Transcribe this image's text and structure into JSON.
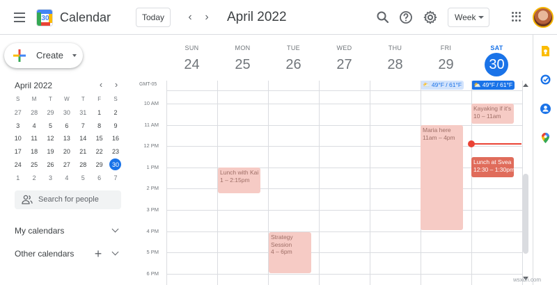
{
  "app": {
    "title": "Calendar",
    "logo_number": "30"
  },
  "header": {
    "today_label": "Today",
    "prev_label": "‹",
    "next_label": "›",
    "month_title": "April 2022",
    "view_select": "Week"
  },
  "sidebar": {
    "create_label": "Create",
    "mini_calendar": {
      "title": "April 2022",
      "prev": "‹",
      "next": "›",
      "weekday_headers": [
        "S",
        "M",
        "T",
        "W",
        "T",
        "F",
        "S"
      ],
      "weeks": [
        [
          "27",
          "28",
          "29",
          "30",
          "31",
          "1",
          "2"
        ],
        [
          "3",
          "4",
          "5",
          "6",
          "7",
          "8",
          "9"
        ],
        [
          "10",
          "11",
          "12",
          "13",
          "14",
          "15",
          "16"
        ],
        [
          "17",
          "18",
          "19",
          "20",
          "21",
          "22",
          "23"
        ],
        [
          "24",
          "25",
          "26",
          "27",
          "28",
          "29",
          "30"
        ],
        [
          "1",
          "2",
          "3",
          "4",
          "5",
          "6",
          "7"
        ]
      ],
      "selected_day": "30"
    },
    "search_people_placeholder": "Search for people",
    "my_calendars_label": "My calendars",
    "other_calendars_label": "Other calendars",
    "add_label": "+"
  },
  "week": {
    "timezone_label": "GMT-05",
    "days": [
      {
        "name": "SUN",
        "num": "24"
      },
      {
        "name": "MON",
        "num": "25"
      },
      {
        "name": "TUE",
        "num": "26"
      },
      {
        "name": "WED",
        "num": "27"
      },
      {
        "name": "THU",
        "num": "28"
      },
      {
        "name": "FRI",
        "num": "29"
      },
      {
        "name": "SAT",
        "num": "30"
      }
    ],
    "weather": {
      "fri": "⛅ 49°F / 61°F",
      "sat": "⛅ 49°F / 61°F"
    },
    "hours": [
      "10 AM",
      "11 AM",
      "12 PM",
      "1 PM",
      "2 PM",
      "3 PM",
      "4 PM",
      "5 PM",
      "6 PM"
    ]
  },
  "events": {
    "lunch_kai": {
      "title": "Lunch with Kai",
      "time": "1 – 2:15pm"
    },
    "strategy": {
      "title": "Strategy",
      "title2": "Session",
      "time": "4 – 6pm"
    },
    "maria": {
      "title": "Maria here",
      "time": "11am – 4pm"
    },
    "kayaking": {
      "title": "Kayaking if it's",
      "time": "10 – 11am"
    },
    "lunch_svea": {
      "title": "Lunch at Svea",
      "time": "12:30 – 1:30pm"
    }
  },
  "colors": {
    "accent": "#1a73e8",
    "event_pale": "#f6cbc5",
    "event_bold": "#e06c5b",
    "now_line": "#ea4335"
  },
  "watermark": "wsxdn.com"
}
